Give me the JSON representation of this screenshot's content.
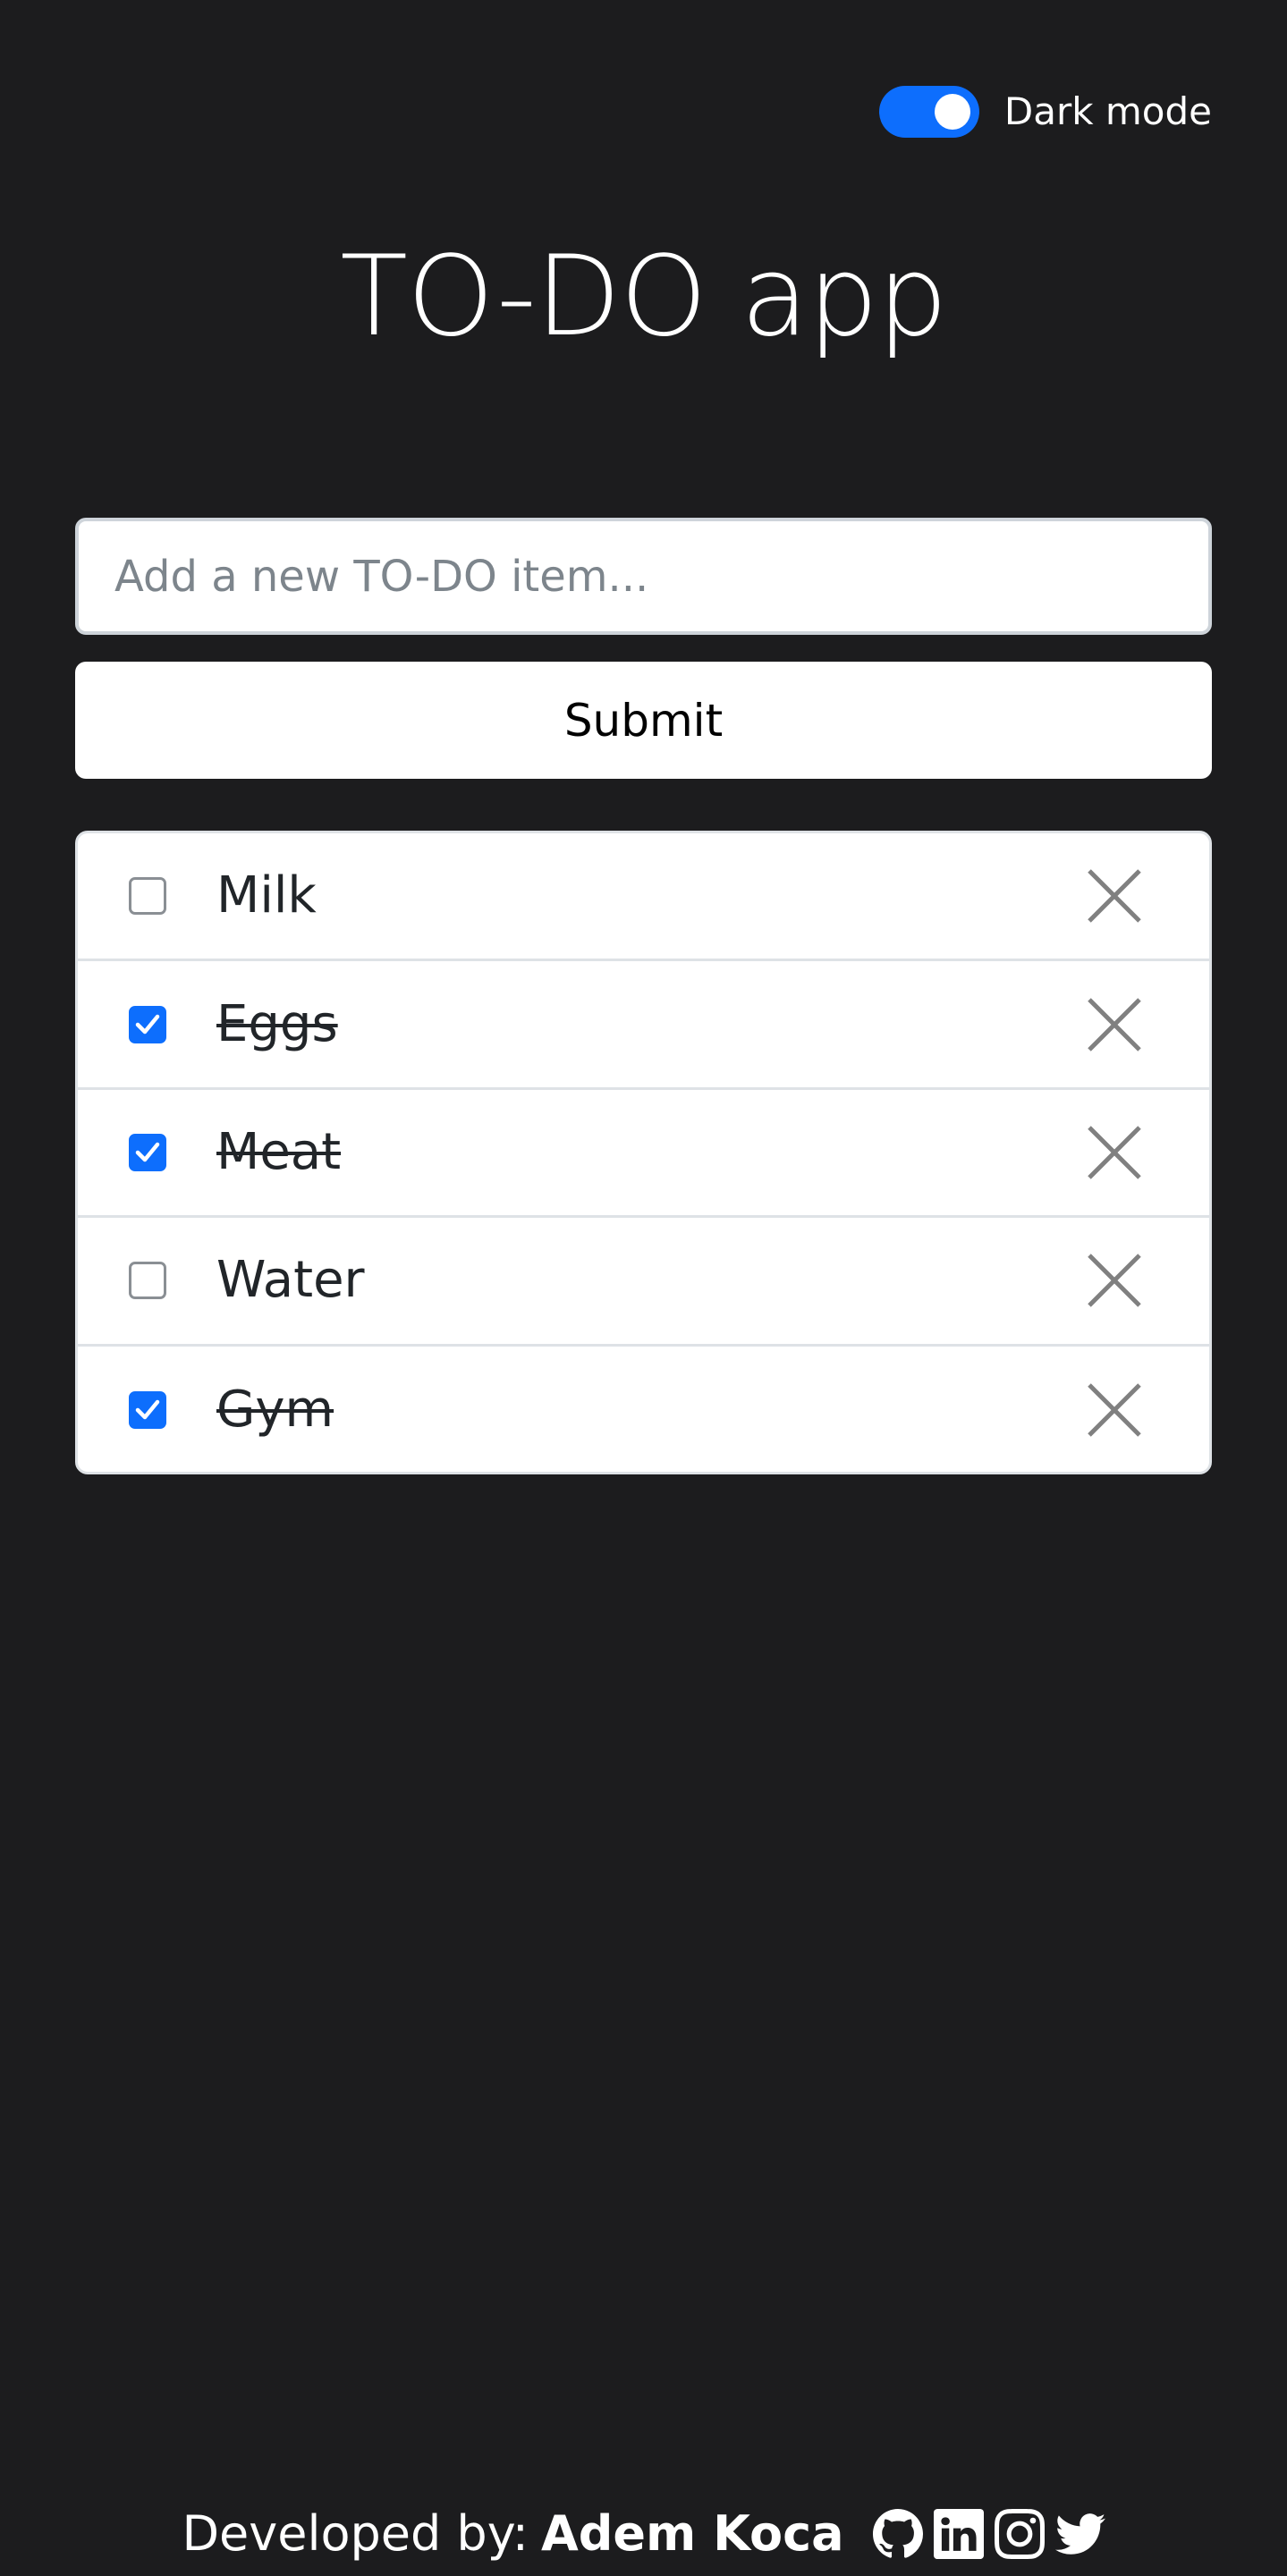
{
  "header": {
    "dark_mode_label": "Dark mode",
    "dark_mode_on": true
  },
  "title": "TO-DO app",
  "form": {
    "input_value": "",
    "input_placeholder": "Add a new TO-DO item...",
    "submit_label": "Submit"
  },
  "todos": [
    {
      "text": "Milk",
      "done": false
    },
    {
      "text": "Eggs",
      "done": true
    },
    {
      "text": "Meat",
      "done": true
    },
    {
      "text": "Water",
      "done": false
    },
    {
      "text": "Gym",
      "done": true
    }
  ],
  "footer": {
    "prefix": "Developed by:",
    "author": "Adem Koca",
    "icons": [
      "github-icon",
      "linkedin-icon",
      "instagram-icon",
      "twitter-icon"
    ]
  },
  "colors": {
    "background": "#1c1c1e",
    "accent": "#0d6efd",
    "delete_icon": "#808080"
  }
}
